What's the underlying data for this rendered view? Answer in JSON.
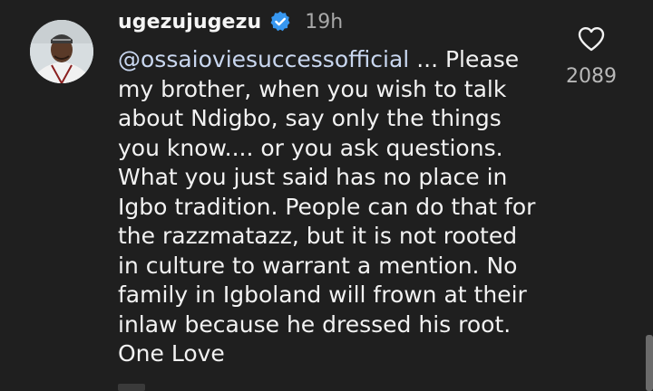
{
  "comment": {
    "username": "ugezujugezu",
    "verified": true,
    "time": "19h",
    "mention": "@ossaioviesuccessofficial",
    "text_first_line_rest": " ... Please",
    "text_lines": [
      "my brother, when you wish to talk",
      "about Ndigbo, say only the things",
      "you know.... or you ask questions.",
      "What you just said has no place in",
      "Igbo tradition. People can do that for",
      "the razzmatazz, but it is not rooted",
      "in culture to warrant a mention. No",
      "family in Igboland will frown at their",
      "inlaw because he dressed his root.",
      "One Love"
    ],
    "like_count": "2089"
  },
  "icons": {
    "verified": "verified-badge-icon",
    "like": "heart-outline-icon",
    "avatar": "user-avatar"
  },
  "colors": {
    "background": "#1f1f1f",
    "text": "#f2f2f2",
    "muted": "#a8a8a8",
    "verified": "#3797f0"
  }
}
